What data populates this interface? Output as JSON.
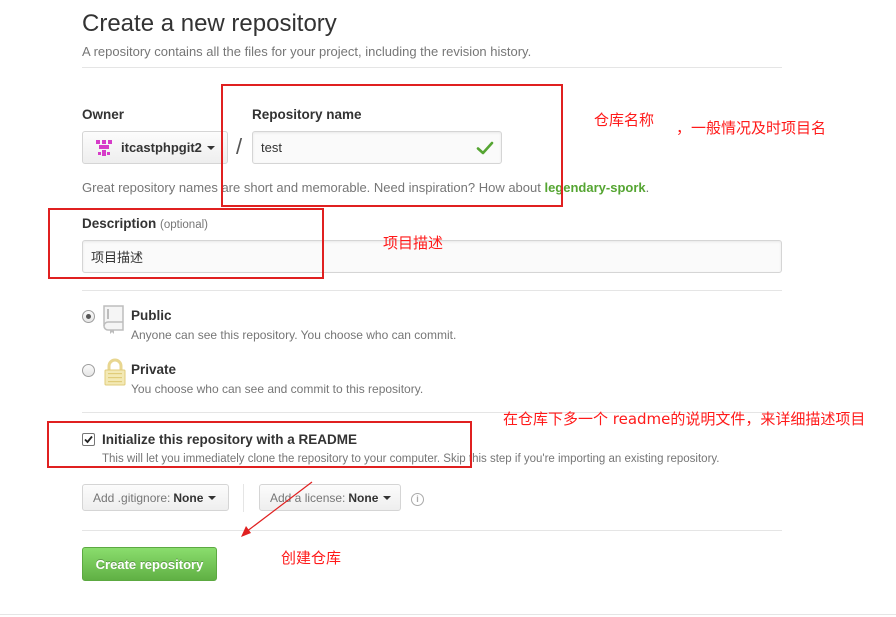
{
  "page": {
    "title": "Create a new repository",
    "subtitle": "A repository contains all the files for your project, including the revision history."
  },
  "owner": {
    "label": "Owner",
    "value": "itcastphpgit2"
  },
  "repo": {
    "label": "Repository name",
    "value": "test",
    "separator": "/"
  },
  "hint": {
    "text_before": "Great repository names are short and memorable. Need inspiration? How about ",
    "suggestion": "legendary-spork",
    "text_after": "."
  },
  "description": {
    "label": "Description",
    "optional": "(optional)",
    "value": "项目描述"
  },
  "visibility": {
    "public_title": "Public",
    "public_desc": "Anyone can see this repository. You choose who can commit.",
    "private_title": "Private",
    "private_desc": "You choose who can see and commit to this repository."
  },
  "readme": {
    "title": "Initialize this repository with a README",
    "desc": "This will let you immediately clone the repository to your computer. Skip this step if you're importing an existing repository."
  },
  "gitignore": {
    "label": "Add .gitignore:",
    "value": "None"
  },
  "license": {
    "label": "Add a license:",
    "value": "None"
  },
  "info_icon_glyph": "i",
  "create_button": "Create repository",
  "annotations": {
    "repo_name": "仓库名称",
    "repo_name_note": "，一般情况及时项目名",
    "description": "项目描述",
    "readme": "在仓库下多一个  readme的说明文件，来详细描述项目",
    "create": "创建仓库"
  },
  "colors": {
    "annotation_red": "#e02020",
    "button_green": "#60b044",
    "suggestion_green": "#55a532"
  }
}
